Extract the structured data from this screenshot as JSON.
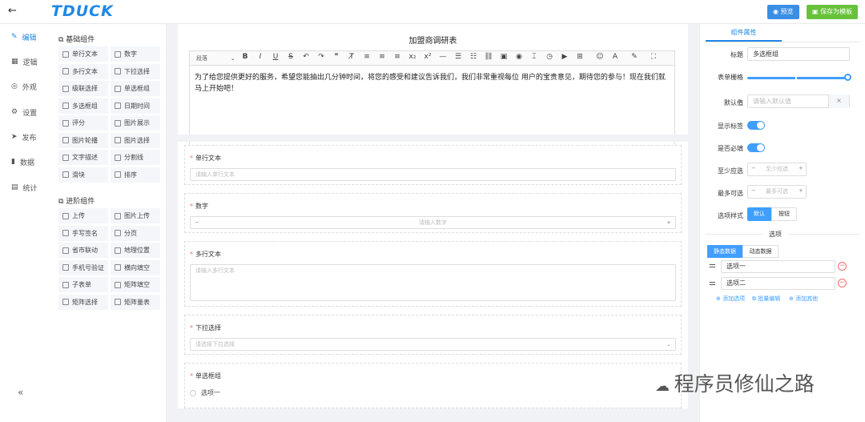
{
  "app": {
    "logo": "TDUCK",
    "back_icon": "arrow-left-icon"
  },
  "header": {
    "preview_label": "预览",
    "save_template_label": "保存为模板"
  },
  "leftnav": {
    "items": [
      {
        "label": "编辑",
        "icon": "edit-icon"
      },
      {
        "label": "逻辑",
        "icon": "grid-icon"
      },
      {
        "label": "外观",
        "icon": "eye-icon"
      },
      {
        "label": "设置",
        "icon": "gear-icon"
      },
      {
        "label": "发布",
        "icon": "send-icon"
      },
      {
        "label": "数据",
        "icon": "bar-chart-icon"
      },
      {
        "label": "统计",
        "icon": "stats-icon"
      }
    ],
    "collapse_icon": "double-chevron-left-icon"
  },
  "palette": {
    "basic_title": "基础组件",
    "basic": [
      "单行文本",
      "数字",
      "多行文本",
      "下拉选择",
      "级联选择",
      "单选框组",
      "多选框组",
      "日期时间",
      "评分",
      "图片展示",
      "图片轮播",
      "图片选择",
      "文字描述",
      "分割线",
      "滑块",
      "排序"
    ],
    "advanced_title": "进阶组件",
    "advanced": [
      "上传",
      "图片上传",
      "手写签名",
      "分页",
      "省市联动",
      "地理位置",
      "手机号验证",
      "横向填空",
      "子表单",
      "矩阵填空",
      "矩阵选择",
      "矩阵量表"
    ]
  },
  "canvas": {
    "title": "加盟商调研表",
    "paragraph_select": "段落",
    "intro": "为了给您提供更好的服务，希望您能抽出几分钟时间，将您的感受和建议告诉我们，我们非常重视每位 用户的宝贵意见，期待您的参与！现在我们就马上开始吧！",
    "fields": [
      {
        "label": "单行文本",
        "placeholder": "请输入单行文本"
      },
      {
        "label": "数字",
        "placeholder": "请输入数字",
        "minus": "−",
        "plus": "+"
      },
      {
        "label": "多行文本",
        "placeholder": "请输入多行文本"
      },
      {
        "label": "下拉选择",
        "placeholder": "请选择下拉选择"
      },
      {
        "label": "单选框组",
        "option1": "选项一"
      }
    ]
  },
  "props": {
    "tab": "组件属性",
    "title_label": "标题",
    "title_value": "多选框组",
    "grid_label": "表单栅格",
    "default_label": "默认值",
    "default_placeholder": "请输入默认值",
    "clear_icon": "×",
    "show_label": "显示标签",
    "required_label": "是否必填",
    "min_label": "至少应选",
    "min_placeholder": "至少应选",
    "max_label": "最多可选",
    "max_placeholder": "最多可选",
    "minus": "−",
    "plus": "+",
    "style_label": "选项样式",
    "style_default": "默认",
    "style_button": "按钮",
    "options_title": "选项",
    "tab_static": "静态数据",
    "tab_dynamic": "动态数据",
    "options": [
      "选项一",
      "选项二"
    ],
    "add_option": "添加选项",
    "batch_edit": "批量编辑",
    "add_other": "添加其他"
  },
  "watermark": "程序员修仙之路",
  "colors": {
    "primary": "#1e88e5",
    "save": "#67c23a",
    "required": "#f56c6c"
  }
}
